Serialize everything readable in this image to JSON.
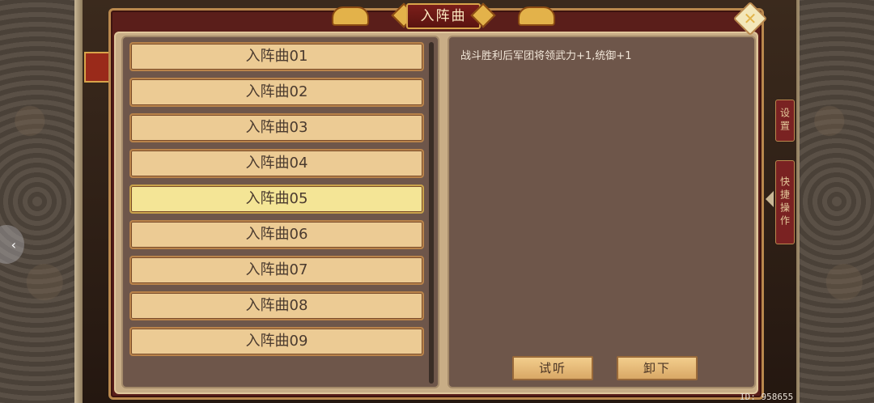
{
  "dialog": {
    "title": "入阵曲",
    "close_icon": "close-icon"
  },
  "songs": [
    {
      "label": "入阵曲01",
      "selected": false
    },
    {
      "label": "入阵曲02",
      "selected": false
    },
    {
      "label": "入阵曲03",
      "selected": false
    },
    {
      "label": "入阵曲04",
      "selected": false
    },
    {
      "label": "入阵曲05",
      "selected": true
    },
    {
      "label": "入阵曲06",
      "selected": false
    },
    {
      "label": "入阵曲07",
      "selected": false
    },
    {
      "label": "入阵曲08",
      "selected": false
    },
    {
      "label": "入阵曲09",
      "selected": false
    }
  ],
  "detail": {
    "description": "战斗胜利后军团将领武力+1,统御+1",
    "listen_label": "试听",
    "remove_label": "卸下"
  },
  "side_tabs": {
    "settings": "设置",
    "shortcut": "快捷操作"
  },
  "player_id": "ID: 958655",
  "colors": {
    "dialog_frame": "#5a1e1a",
    "panel_bg": "#6e564a",
    "item_bg": "#eccb94",
    "item_selected_bg": "#f4e596"
  }
}
